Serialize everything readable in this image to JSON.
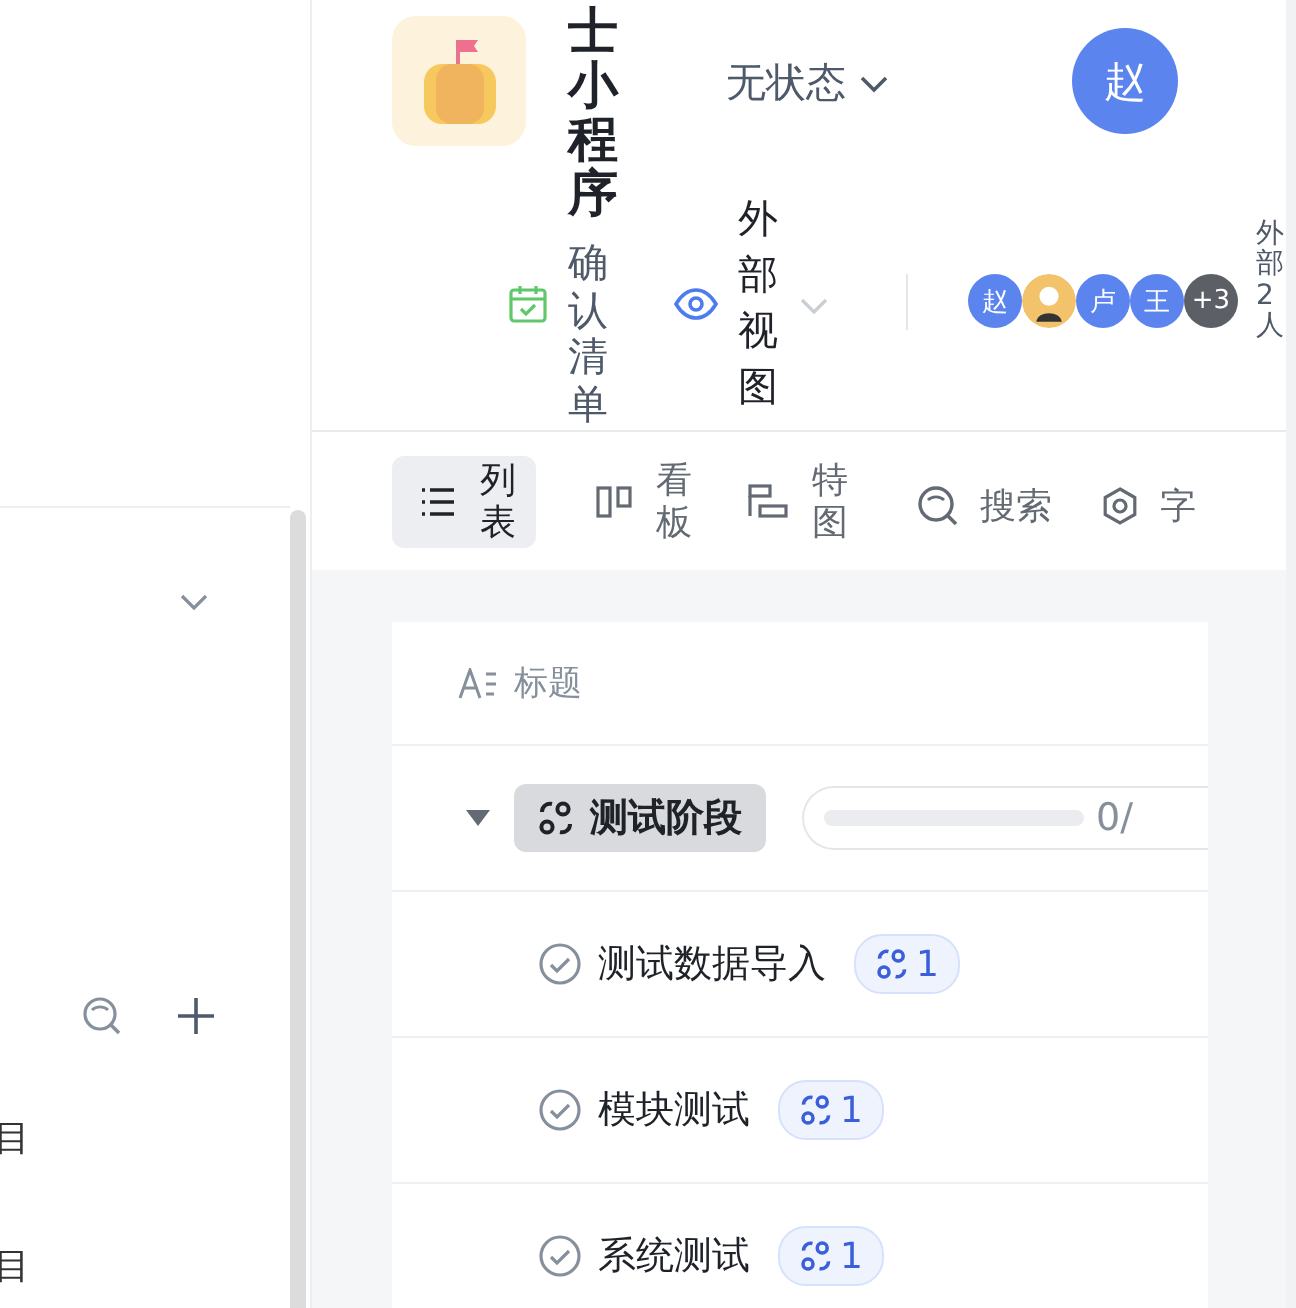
{
  "sidebar": {
    "items": [
      {
        "label": "目"
      },
      {
        "label": "目"
      }
    ]
  },
  "project": {
    "title": "士小程序",
    "status": "无状态",
    "owner": "赵"
  },
  "header_actions": [
    {
      "kind": "checklist",
      "label": "确认清单"
    },
    {
      "kind": "view",
      "label": "外部视图"
    }
  ],
  "members": {
    "avatars": [
      {
        "kind": "letter",
        "initial": "赵",
        "color": "#5b84ef"
      },
      {
        "kind": "picture",
        "color": "#f2c36b"
      },
      {
        "kind": "letter",
        "initial": "卢",
        "color": "#5b84ef"
      },
      {
        "kind": "letter",
        "initial": "王",
        "color": "#5b84ef"
      },
      {
        "kind": "more",
        "initial": "+3",
        "color": "#5c5f66"
      }
    ],
    "count": "外部2人"
  },
  "views": [
    {
      "kind": "list",
      "label": "列表",
      "selected": true
    },
    {
      "kind": "board",
      "label": "看板",
      "selected": false
    },
    {
      "kind": "gantt",
      "label": "特图",
      "selected": false
    }
  ],
  "tools": [
    {
      "kind": "search",
      "label": "搜索"
    },
    {
      "kind": "fields",
      "label": "字"
    }
  ],
  "table": {
    "column": "标题",
    "group": {
      "label": "测试阶段",
      "expanded": true,
      "level": 0,
      "progress": "0/"
    },
    "rows": [
      {
        "title": "测试数据导入",
        "count": "1"
      },
      {
        "title": "模块测试",
        "count": "1"
      },
      {
        "title": "系统测试",
        "count": "1"
      }
    ]
  }
}
